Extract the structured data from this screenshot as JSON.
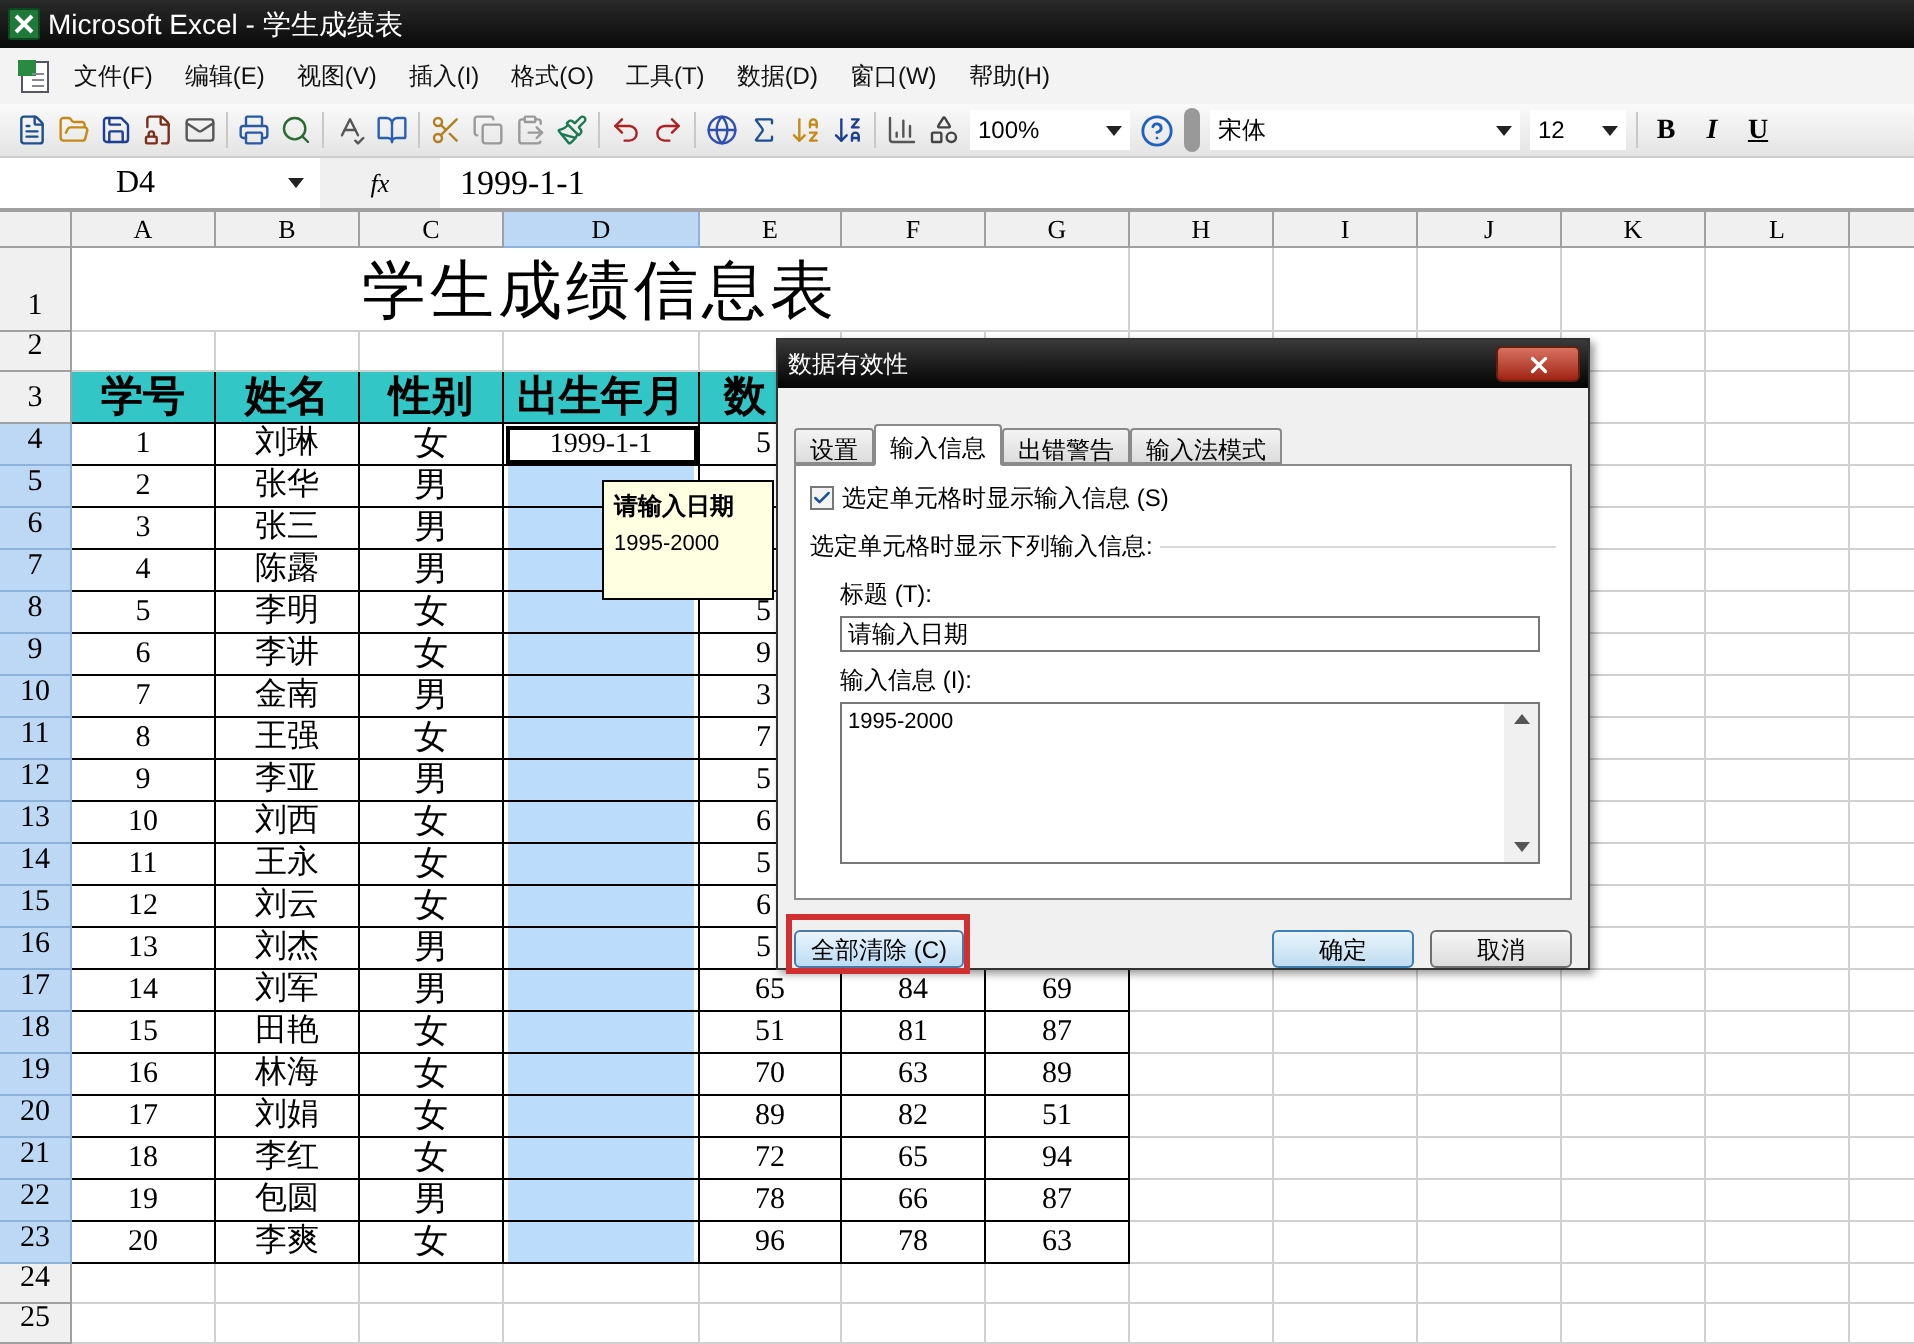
{
  "window": {
    "title": "Microsoft Excel - 学生成绩表"
  },
  "menu": [
    "文件(F)",
    "编辑(E)",
    "视图(V)",
    "插入(I)",
    "格式(O)",
    "工具(T)",
    "数据(D)",
    "窗口(W)",
    "帮助(H)"
  ],
  "toolbar": {
    "zoom": "100%",
    "font": "宋体",
    "font_size": "12",
    "format_buttons": [
      "B",
      "I",
      "U"
    ]
  },
  "formula_bar": {
    "cell_ref": "D4",
    "fx": "fx",
    "value": "1999-1-1"
  },
  "sheet": {
    "columns": [
      {
        "label": "A",
        "selected": false
      },
      {
        "label": "B",
        "selected": false
      },
      {
        "label": "C",
        "selected": false
      },
      {
        "label": "D",
        "selected": true
      },
      {
        "label": "E",
        "selected": false
      },
      {
        "label": "F",
        "selected": false
      },
      {
        "label": "G",
        "selected": false
      },
      {
        "label": "H",
        "selected": false
      },
      {
        "label": "I",
        "selected": false
      },
      {
        "label": "J",
        "selected": false
      },
      {
        "label": "K",
        "selected": false
      },
      {
        "label": "L",
        "selected": false
      }
    ],
    "rows": [
      {
        "kind": "title",
        "label": "1",
        "selected": false,
        "text": "学生成绩信息表"
      },
      {
        "kind": "blank",
        "label": "2",
        "selected": false
      },
      {
        "kind": "header",
        "label": "3",
        "selected": false,
        "cells": [
          "学号",
          "姓名",
          "性别",
          "出生年月",
          "数"
        ]
      },
      {
        "kind": "data",
        "label": "4",
        "selected": true,
        "active": true,
        "number": "1",
        "name": "刘琳",
        "gender": "女",
        "birth": "1999-1-1",
        "scores": [
          "5"
        ]
      },
      {
        "kind": "data",
        "label": "5",
        "selected": true,
        "active": false,
        "number": "2",
        "name": "张华",
        "gender": "男"
      },
      {
        "kind": "data",
        "label": "6",
        "selected": true,
        "active": false,
        "number": "3",
        "name": "张三",
        "gender": "男"
      },
      {
        "kind": "data",
        "label": "7",
        "selected": true,
        "active": false,
        "number": "4",
        "name": "陈露",
        "gender": "男"
      },
      {
        "kind": "data",
        "label": "8",
        "selected": true,
        "active": false,
        "number": "5",
        "name": "李明",
        "gender": "女",
        "scores": [
          "5"
        ]
      },
      {
        "kind": "data",
        "label": "9",
        "selected": true,
        "active": false,
        "number": "6",
        "name": "李讲",
        "gender": "女",
        "scores": [
          "9"
        ]
      },
      {
        "kind": "data",
        "label": "10",
        "selected": true,
        "active": false,
        "number": "7",
        "name": "金南",
        "gender": "男",
        "scores": [
          "3"
        ]
      },
      {
        "kind": "data",
        "label": "11",
        "selected": true,
        "active": false,
        "number": "8",
        "name": "王强",
        "gender": "女",
        "scores": [
          "7"
        ]
      },
      {
        "kind": "data",
        "label": "12",
        "selected": true,
        "active": false,
        "number": "9",
        "name": "李亚",
        "gender": "男",
        "scores": [
          "5"
        ]
      },
      {
        "kind": "data",
        "label": "13",
        "selected": true,
        "active": false,
        "number": "10",
        "name": "刘西",
        "gender": "女",
        "scores": [
          "6"
        ]
      },
      {
        "kind": "data",
        "label": "14",
        "selected": true,
        "active": false,
        "number": "11",
        "name": "王永",
        "gender": "女",
        "scores": [
          "5"
        ]
      },
      {
        "kind": "data",
        "label": "15",
        "selected": true,
        "active": false,
        "number": "12",
        "name": "刘云",
        "gender": "女",
        "scores": [
          "6"
        ]
      },
      {
        "kind": "data",
        "label": "16",
        "selected": true,
        "active": false,
        "number": "13",
        "name": "刘杰",
        "gender": "男",
        "scores": [
          "5"
        ]
      },
      {
        "kind": "data",
        "label": "17",
        "selected": true,
        "active": false,
        "number": "14",
        "name": "刘军",
        "gender": "男",
        "scores": [
          "65",
          "84",
          "69"
        ]
      },
      {
        "kind": "data",
        "label": "18",
        "selected": true,
        "active": false,
        "number": "15",
        "name": "田艳",
        "gender": "女",
        "scores": [
          "51",
          "81",
          "87"
        ]
      },
      {
        "kind": "data",
        "label": "19",
        "selected": true,
        "active": false,
        "number": "16",
        "name": "林海",
        "gender": "女",
        "scores": [
          "70",
          "63",
          "89"
        ]
      },
      {
        "kind": "data",
        "label": "20",
        "selected": true,
        "active": false,
        "number": "17",
        "name": "刘娟",
        "gender": "女",
        "scores": [
          "89",
          "82",
          "51"
        ]
      },
      {
        "kind": "data",
        "label": "21",
        "selected": true,
        "active": false,
        "number": "18",
        "name": "李红",
        "gender": "女",
        "scores": [
          "72",
          "65",
          "94"
        ]
      },
      {
        "kind": "data",
        "label": "22",
        "selected": true,
        "active": false,
        "number": "19",
        "name": "包圆",
        "gender": "男",
        "scores": [
          "78",
          "66",
          "87"
        ]
      },
      {
        "kind": "data",
        "label": "23",
        "selected": true,
        "active": false,
        "number": "20",
        "name": "李爽",
        "gender": "女",
        "scores": [
          "96",
          "78",
          "63"
        ]
      },
      {
        "kind": "blank",
        "label": "24",
        "selected": false
      },
      {
        "kind": "blank",
        "label": "25",
        "selected": false
      }
    ]
  },
  "tooltip": {
    "title": "请输入日期",
    "text": "1995-2000"
  },
  "dialog": {
    "title": "数据有效性",
    "tabs": [
      {
        "label": "设置",
        "selected": false
      },
      {
        "label": "输入信息",
        "selected": true
      },
      {
        "label": "出错警告",
        "selected": false
      },
      {
        "label": "输入法模式",
        "selected": false
      }
    ],
    "show_message": {
      "label": "选定单元格时显示输入信息 (S)",
      "checked": true
    },
    "section_label": "选定单元格时显示下列输入信息:",
    "title_label": "标题 (T):",
    "title_value": "请输入日期",
    "message_label": "输入信息 (I):",
    "message_value": "1995-2000",
    "clear_button": {
      "label": "全部清除 (C)",
      "highlighted": true
    },
    "buttons": [
      "确定",
      "取消"
    ]
  }
}
